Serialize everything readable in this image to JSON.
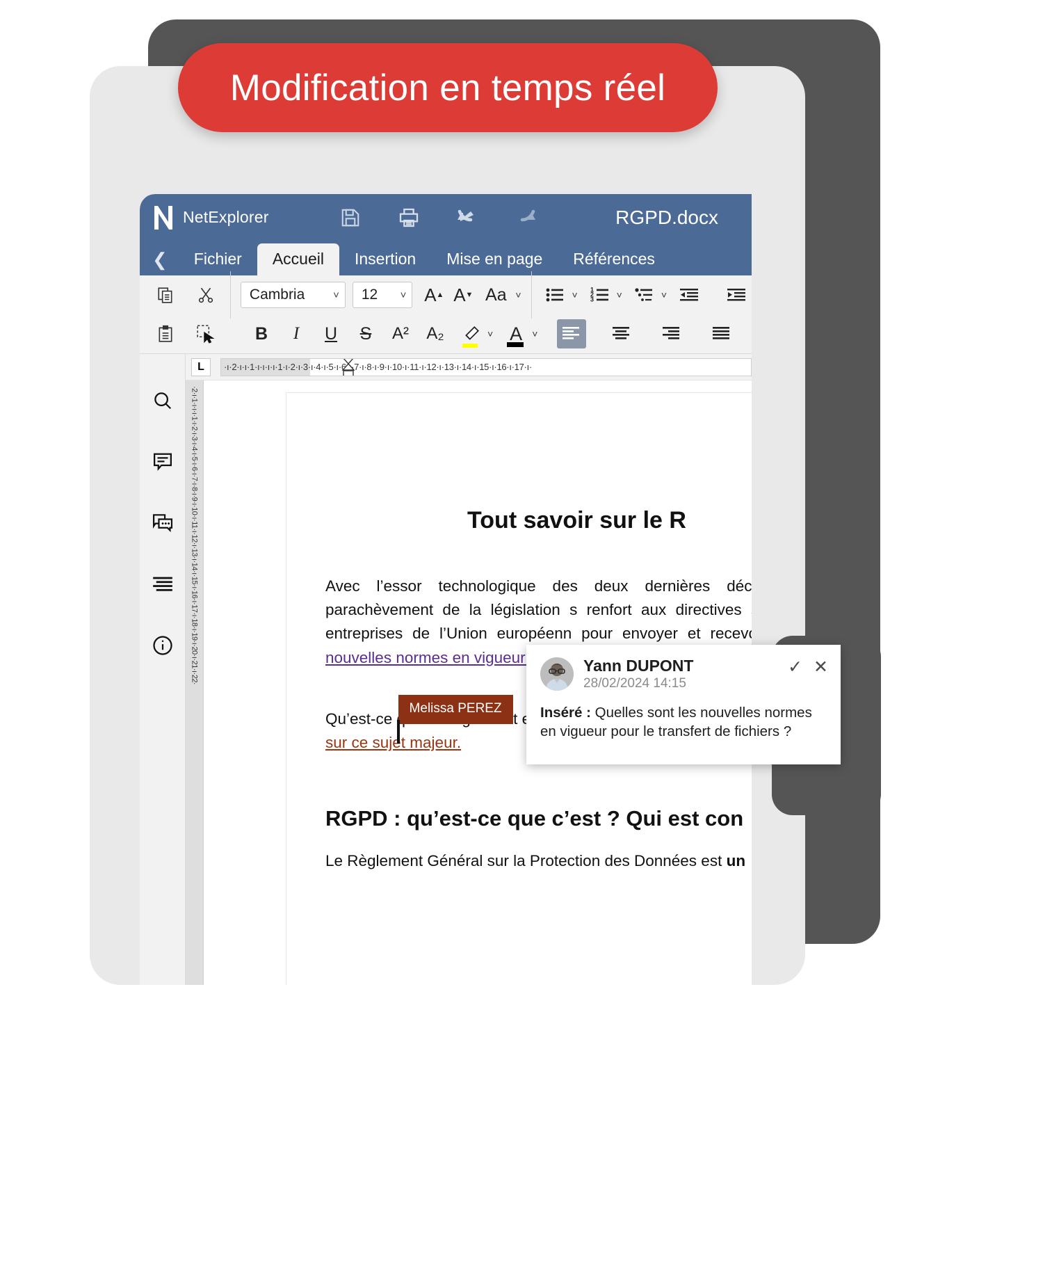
{
  "badge": {
    "label": "Modification en temps réel"
  },
  "titlebar": {
    "app_name": "NetExplorer",
    "document_title": "RGPD.docx",
    "icons": [
      "save-icon",
      "print-icon",
      "undo-icon",
      "redo-icon"
    ]
  },
  "tabs": [
    {
      "label": "Fichier",
      "active": false
    },
    {
      "label": "Accueil",
      "active": true
    },
    {
      "label": "Insertion",
      "active": false
    },
    {
      "label": "Mise en page",
      "active": false
    },
    {
      "label": "Références",
      "active": false
    }
  ],
  "ribbon": {
    "font_name": "Cambria",
    "font_size": "12",
    "grow_font": "A",
    "shrink_font": "A",
    "change_case": "Aa",
    "bold": "B",
    "italic": "I",
    "underline": "U",
    "strikethrough": "S",
    "superscript": "A²",
    "subscript": "A₂"
  },
  "ruler": {
    "tab_stop": "L",
    "ticks": "·ı·2·ı·ı·1·ı·ı·ı·ı·1·ı·2·ı·3·ı·4·ı·5·ı·6·ı·7·ı·8·ı·9·ı·10·ı·11·ı·12·ı·13·ı·14·ı·15·ı·16·ı·17·ı·",
    "vertical_ticks": "·2·ı·1·ı·ı·ı·1·ı·2·ı·3·ı·4·ı·5·ı·6·ı·7·ı·8·ı·9·ı·10·ı·11·ı·12·ı·13·ı·14·ı·15·ı·16·ı·17·ı·18·ı·19·ı·20·ı·21·ı·22·"
  },
  "sidebar": {
    "items": [
      {
        "icon": "search-icon",
        "name": "search"
      },
      {
        "icon": "comment-icon",
        "name": "comments"
      },
      {
        "icon": "chat-icon",
        "name": "chat"
      },
      {
        "icon": "text-lines-icon",
        "name": "outline"
      },
      {
        "icon": "info-icon",
        "name": "info"
      }
    ]
  },
  "document": {
    "heading1": "Tout savoir sur le R",
    "paragraph1_plain": "Avec l’essor technologique des deux dernières décennies, il parachèvement de la législation s renfort aux directives  sur la pro entreprises de l’Union européenn pour envoyer et recevoir des fic ",
    "paragraph1_inserted": "nouvelles normes en  vigueur pou",
    "paragraph2_plain": "Qu’est-ce ",
    "paragraph2_rest": "que ce règlement et quels sont ses objectifs prin",
    "paragraph2_deleted": "sur ce sujet majeur.",
    "heading2": "RGPD : qu’est-ce que c’est ? Qui est con",
    "paragraph3_start": "Le Règlement Général sur la Protection des Données est ",
    "paragraph3_bold": "un"
  },
  "collaborator": {
    "name": "Melissa PEREZ",
    "color": "#8c3114"
  },
  "comment": {
    "author": "Yann DUPONT",
    "timestamp": "28/02/2024 14:15",
    "body_label": "Inséré :",
    "body_text": " Quelles sont les nouvelles normes en  vigueur pour le transfert de fichiers ?",
    "accept_icon": "check-icon",
    "reject_icon": "close-icon"
  },
  "colors": {
    "titlebar": "#4c6a96",
    "badge": "#dd3b35",
    "frame": "#e9e9e9",
    "slab": "#555555",
    "inserted_text": "#5b2d91",
    "deleted_text": "#9c3412"
  }
}
